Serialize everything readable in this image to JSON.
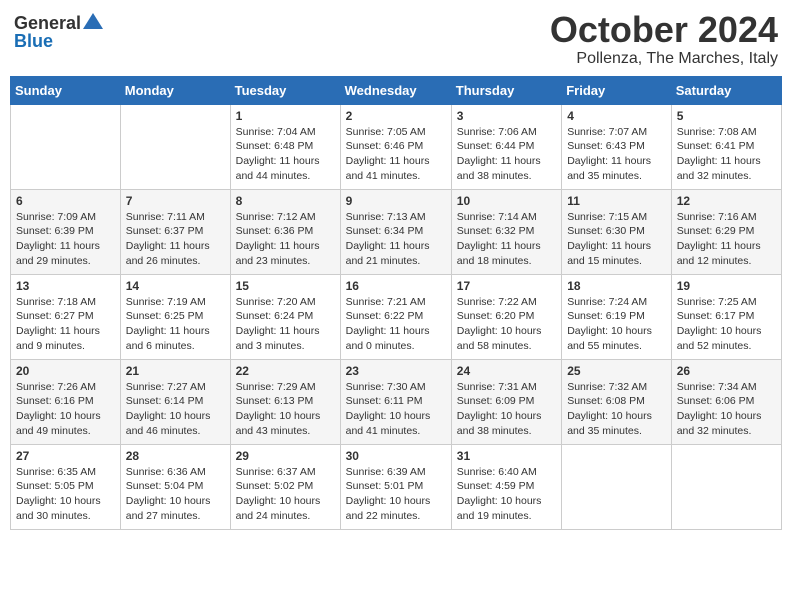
{
  "header": {
    "logo_general": "General",
    "logo_blue": "Blue",
    "month_title": "October 2024",
    "location": "Pollenza, The Marches, Italy"
  },
  "weekdays": [
    "Sunday",
    "Monday",
    "Tuesday",
    "Wednesday",
    "Thursday",
    "Friday",
    "Saturday"
  ],
  "weeks": [
    [
      {
        "day": "",
        "info": ""
      },
      {
        "day": "",
        "info": ""
      },
      {
        "day": "1",
        "info": "Sunrise: 7:04 AM\nSunset: 6:48 PM\nDaylight: 11 hours and 44 minutes."
      },
      {
        "day": "2",
        "info": "Sunrise: 7:05 AM\nSunset: 6:46 PM\nDaylight: 11 hours and 41 minutes."
      },
      {
        "day": "3",
        "info": "Sunrise: 7:06 AM\nSunset: 6:44 PM\nDaylight: 11 hours and 38 minutes."
      },
      {
        "day": "4",
        "info": "Sunrise: 7:07 AM\nSunset: 6:43 PM\nDaylight: 11 hours and 35 minutes."
      },
      {
        "day": "5",
        "info": "Sunrise: 7:08 AM\nSunset: 6:41 PM\nDaylight: 11 hours and 32 minutes."
      }
    ],
    [
      {
        "day": "6",
        "info": "Sunrise: 7:09 AM\nSunset: 6:39 PM\nDaylight: 11 hours and 29 minutes."
      },
      {
        "day": "7",
        "info": "Sunrise: 7:11 AM\nSunset: 6:37 PM\nDaylight: 11 hours and 26 minutes."
      },
      {
        "day": "8",
        "info": "Sunrise: 7:12 AM\nSunset: 6:36 PM\nDaylight: 11 hours and 23 minutes."
      },
      {
        "day": "9",
        "info": "Sunrise: 7:13 AM\nSunset: 6:34 PM\nDaylight: 11 hours and 21 minutes."
      },
      {
        "day": "10",
        "info": "Sunrise: 7:14 AM\nSunset: 6:32 PM\nDaylight: 11 hours and 18 minutes."
      },
      {
        "day": "11",
        "info": "Sunrise: 7:15 AM\nSunset: 6:30 PM\nDaylight: 11 hours and 15 minutes."
      },
      {
        "day": "12",
        "info": "Sunrise: 7:16 AM\nSunset: 6:29 PM\nDaylight: 11 hours and 12 minutes."
      }
    ],
    [
      {
        "day": "13",
        "info": "Sunrise: 7:18 AM\nSunset: 6:27 PM\nDaylight: 11 hours and 9 minutes."
      },
      {
        "day": "14",
        "info": "Sunrise: 7:19 AM\nSunset: 6:25 PM\nDaylight: 11 hours and 6 minutes."
      },
      {
        "day": "15",
        "info": "Sunrise: 7:20 AM\nSunset: 6:24 PM\nDaylight: 11 hours and 3 minutes."
      },
      {
        "day": "16",
        "info": "Sunrise: 7:21 AM\nSunset: 6:22 PM\nDaylight: 11 hours and 0 minutes."
      },
      {
        "day": "17",
        "info": "Sunrise: 7:22 AM\nSunset: 6:20 PM\nDaylight: 10 hours and 58 minutes."
      },
      {
        "day": "18",
        "info": "Sunrise: 7:24 AM\nSunset: 6:19 PM\nDaylight: 10 hours and 55 minutes."
      },
      {
        "day": "19",
        "info": "Sunrise: 7:25 AM\nSunset: 6:17 PM\nDaylight: 10 hours and 52 minutes."
      }
    ],
    [
      {
        "day": "20",
        "info": "Sunrise: 7:26 AM\nSunset: 6:16 PM\nDaylight: 10 hours and 49 minutes."
      },
      {
        "day": "21",
        "info": "Sunrise: 7:27 AM\nSunset: 6:14 PM\nDaylight: 10 hours and 46 minutes."
      },
      {
        "day": "22",
        "info": "Sunrise: 7:29 AM\nSunset: 6:13 PM\nDaylight: 10 hours and 43 minutes."
      },
      {
        "day": "23",
        "info": "Sunrise: 7:30 AM\nSunset: 6:11 PM\nDaylight: 10 hours and 41 minutes."
      },
      {
        "day": "24",
        "info": "Sunrise: 7:31 AM\nSunset: 6:09 PM\nDaylight: 10 hours and 38 minutes."
      },
      {
        "day": "25",
        "info": "Sunrise: 7:32 AM\nSunset: 6:08 PM\nDaylight: 10 hours and 35 minutes."
      },
      {
        "day": "26",
        "info": "Sunrise: 7:34 AM\nSunset: 6:06 PM\nDaylight: 10 hours and 32 minutes."
      }
    ],
    [
      {
        "day": "27",
        "info": "Sunrise: 6:35 AM\nSunset: 5:05 PM\nDaylight: 10 hours and 30 minutes."
      },
      {
        "day": "28",
        "info": "Sunrise: 6:36 AM\nSunset: 5:04 PM\nDaylight: 10 hours and 27 minutes."
      },
      {
        "day": "29",
        "info": "Sunrise: 6:37 AM\nSunset: 5:02 PM\nDaylight: 10 hours and 24 minutes."
      },
      {
        "day": "30",
        "info": "Sunrise: 6:39 AM\nSunset: 5:01 PM\nDaylight: 10 hours and 22 minutes."
      },
      {
        "day": "31",
        "info": "Sunrise: 6:40 AM\nSunset: 4:59 PM\nDaylight: 10 hours and 19 minutes."
      },
      {
        "day": "",
        "info": ""
      },
      {
        "day": "",
        "info": ""
      }
    ]
  ]
}
